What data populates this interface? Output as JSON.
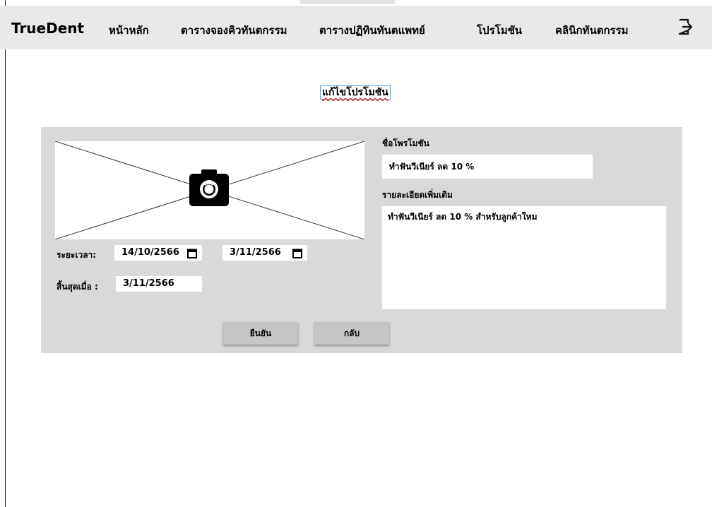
{
  "navbar": {
    "brand": "TrueDent",
    "links": [
      "หน้าหลัก",
      "ตารางจองคิวทันตกรรม",
      "ตารางปฏิทินทันตแพทย์",
      "โปรโมชัน",
      "คลินิกทันตกรรม"
    ],
    "logout_icon": "logout-icon"
  },
  "page": {
    "title": "แก้ไขโปรโมชัน"
  },
  "form": {
    "image_icon": "camera-icon",
    "period_label": "ระยะเวลา:",
    "start_date": "14/10/2566",
    "end_date": "3/11/2566",
    "expire_label": "สิ้นสุดเมื่อ :",
    "expire_date": "3/11/2566",
    "name_label": "ชื่อโพรโมชัน",
    "name_value": "ทำฟันวีเนียร์ ลด 10 %",
    "detail_label": "รายละเอียดเพิ่มเติม",
    "detail_value": "ทำฟันวีเนียร์ ลด 10 % สำหรับลูกค้าใหม",
    "confirm_label": "ยืนยัน",
    "back_label": "กลับ"
  },
  "colors": {
    "navbar_bg": "#e9e9e9",
    "panel_bg": "#d9d9d9",
    "button_bg": "#c5c5c5",
    "title_outline": "#4aa3df"
  }
}
